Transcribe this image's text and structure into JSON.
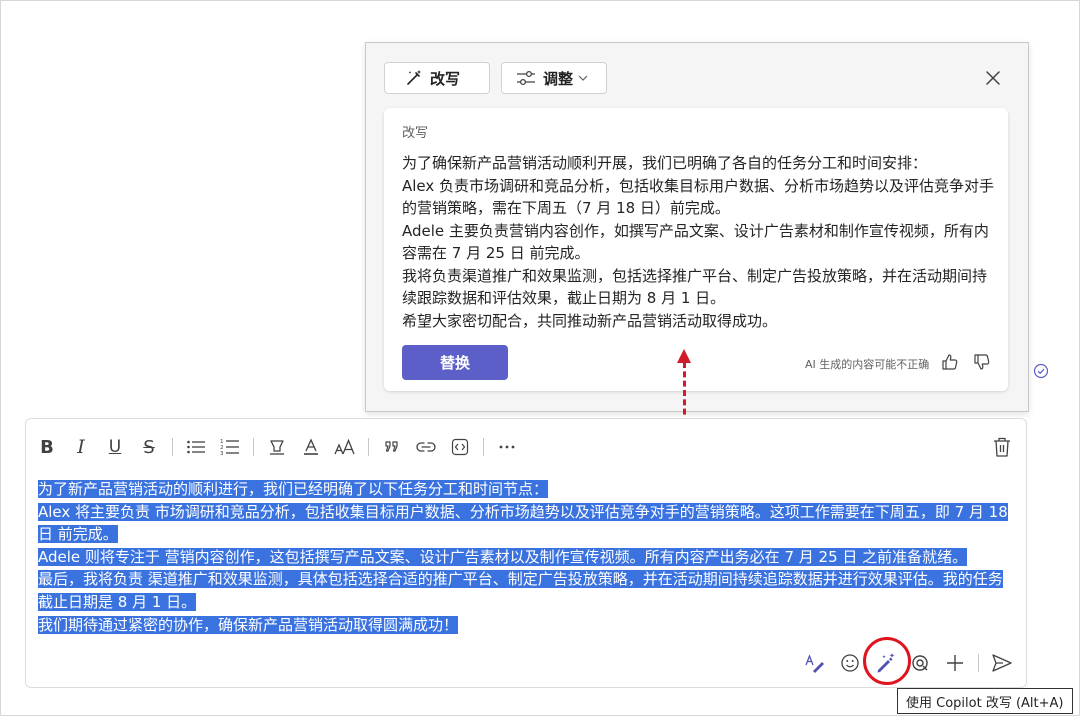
{
  "popup": {
    "rewrite_tab": "改写",
    "adjust_tab": "调整",
    "card_label": "改写",
    "rewritten_lines": [
      "为了确保新产品营销活动顺利开展，我们已明确了各自的任务分工和时间安排：",
      "Alex 负责市场调研和竞品分析，包括收集目标用户数据、分析市场趋势以及评估竞争对手的营销策略，需在下周五（7 月 18 日）前完成。",
      "Adele 主要负责营销内容创作，如撰写产品文案、设计广告素材和制作宣传视频，所有内容需在 7 月 25 日 前完成。",
      "我将负责渠道推广和效果监测，包括选择推广平台、制定广告投放策略，并在活动期间持续跟踪数据和评估效果，截止日期为 8 月 1 日。",
      "希望大家密切配合，共同推动新产品营销活动取得成功。"
    ],
    "replace_label": "替换",
    "disclaimer": "AI 生成的内容可能不正确"
  },
  "compose": {
    "toolbar_icons": [
      "bold-icon",
      "italic-icon",
      "underline-icon",
      "strikethrough-icon",
      "bullet-list-icon",
      "numbered-list-icon",
      "highlight-icon",
      "font-color-icon",
      "font-size-icon",
      "quote-icon",
      "link-icon",
      "code-icon",
      "more-icon"
    ],
    "original_lines": [
      "为了新产品营销活动的顺利进行，我们已经明确了以下任务分工和时间节点：",
      "Alex 将主要负责 市场调研和竞品分析，包括收集目标用户数据、分析市场趋势以及评估竞争对手的营销策略。这项工作需要在下周五，即 7 月 18 日 前完成。",
      "Adele 则将专注于 营销内容创作，这包括撰写产品文案、设计广告素材以及制作宣传视频。所有内容产出务必在 7 月 25 日 之前准备就绪。",
      "最后，我将负责 渠道推广和效果监测，具体包括选择合适的推广平台、制定广告投放策略，并在活动期间持续追踪数据并进行效果评估。我的任务截止日期是 8 月 1 日。",
      "我们期待通过紧密的协作，确保新产品营销活动取得圆满成功！"
    ],
    "tooltip": "使用 Copilot 改写 (Alt+A)"
  },
  "colors": {
    "accent": "#5b5fc7",
    "selection": "#3a73e0",
    "annotation_red": "#d11a2a"
  }
}
